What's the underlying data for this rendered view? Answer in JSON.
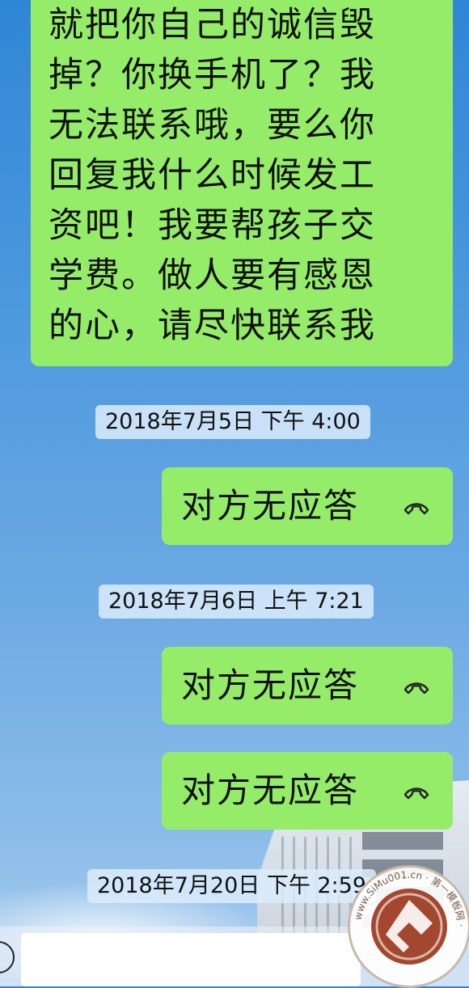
{
  "message_long": {
    "lines": [
      "就把你自己的诚信毁",
      "掉？你换手机了？我",
      "无法联系哦，要么你",
      "回复我什么时候发工",
      "资吧！我要帮孩子交",
      "学费。做人要有感恩",
      "的心，请尽快联系我"
    ]
  },
  "timestamps": [
    "2018年7月5日 下午 4:00",
    "2018年7月6日 上午 7:21",
    "2018年7月20日 下午 2:59"
  ],
  "calls": [
    "对方无应答",
    "对方无应答",
    "对方无应答"
  ],
  "colors": {
    "bubble": "#95ec69",
    "sky": "#4b98de"
  },
  "icons": {
    "call_status": "phone-hangup-icon",
    "voice": "voice-input-icon"
  },
  "watermark": {
    "text": "第一模板网 www.SiMu001.cn"
  }
}
